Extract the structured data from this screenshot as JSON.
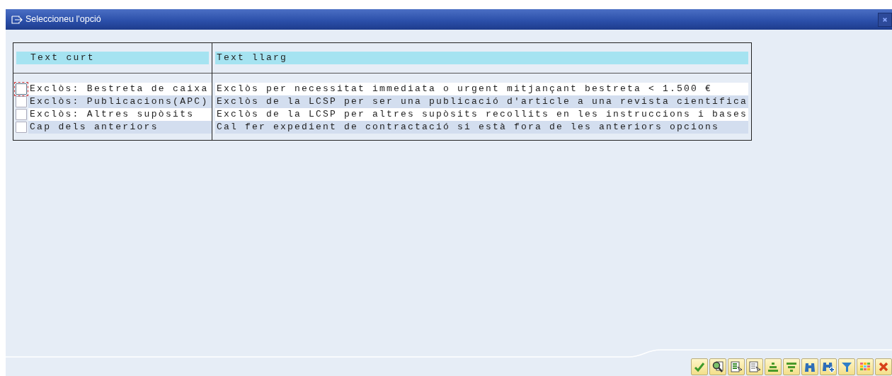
{
  "window": {
    "title": "Seleccioneu l'opció"
  },
  "table": {
    "columns": [
      "Text curt",
      "Text llarg"
    ],
    "rows": [
      {
        "short": "Exclòs: Bestreta de caixa",
        "long": "Exclòs per necessitat immediata o urgent mitjançant bestreta < 1.500 €",
        "checked": false,
        "focused": true
      },
      {
        "short": "Exclòs: Publicacions(APC)",
        "long": "Exclòs de la LCSP per ser una publicació d'article a una revista científica",
        "checked": false,
        "focused": false
      },
      {
        "short": "Exclòs: Altres supòsits",
        "long": "Exclòs de la LCSP per altres supòsits recollits en les instruccions i bases",
        "checked": false,
        "focused": false
      },
      {
        "short": "Cap dels anteriors",
        "long": "Cal fer expedient de contractació si està fora de les anteriors opcions",
        "checked": false,
        "focused": false
      }
    ]
  }
}
